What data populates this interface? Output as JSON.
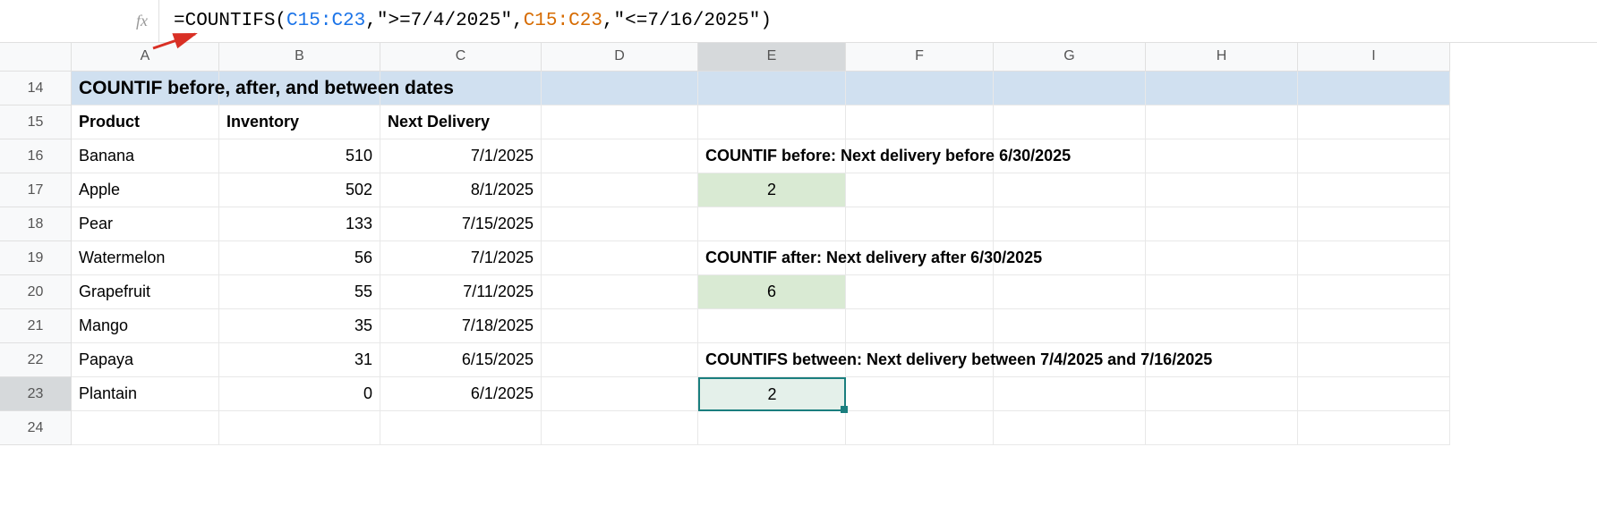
{
  "formula": {
    "prefix": "=COUNTIFS(",
    "range1": "C15:C23",
    "sep1": ", ",
    "crit1": "\">=7/4/2025\"",
    "sep2": ", ",
    "range2": "C15:C23",
    "sep3": ", ",
    "crit2": "\"<=7/16/2025\"",
    "suffix": ")"
  },
  "columns": [
    "A",
    "B",
    "C",
    "D",
    "E",
    "F",
    "G",
    "H",
    "I"
  ],
  "selected_col": "E",
  "selected_row": "23",
  "rows": [
    "14",
    "15",
    "16",
    "17",
    "18",
    "19",
    "20",
    "21",
    "22",
    "23",
    "24"
  ],
  "data": {
    "r14": {
      "title": "COUNTIF before, after, and between dates"
    },
    "r15": {
      "A": "Product",
      "B": "Inventory",
      "C": "Next Delivery"
    },
    "r16": {
      "A": "Banana",
      "B": "510",
      "C": "7/1/2025",
      "E": "COUNTIF before: Next delivery before 6/30/2025"
    },
    "r17": {
      "A": "Apple",
      "B": "502",
      "C": "8/1/2025",
      "E": "2"
    },
    "r18": {
      "A": "Pear",
      "B": "133",
      "C": "7/15/2025"
    },
    "r19": {
      "A": "Watermelon",
      "B": "56",
      "C": "7/1/2025",
      "E": "COUNTIF after: Next delivery after 6/30/2025"
    },
    "r20": {
      "A": "Grapefruit",
      "B": "55",
      "C": "7/11/2025",
      "E": "6"
    },
    "r21": {
      "A": "Mango",
      "B": "35",
      "C": "7/18/2025"
    },
    "r22": {
      "A": "Papaya",
      "B": "31",
      "C": "6/15/2025",
      "E": "COUNTIFS between: Next delivery between 7/4/2025 and 7/16/2025"
    },
    "r23": {
      "A": "Plantain",
      "B": "0",
      "C": "6/1/2025",
      "E": "2"
    }
  }
}
